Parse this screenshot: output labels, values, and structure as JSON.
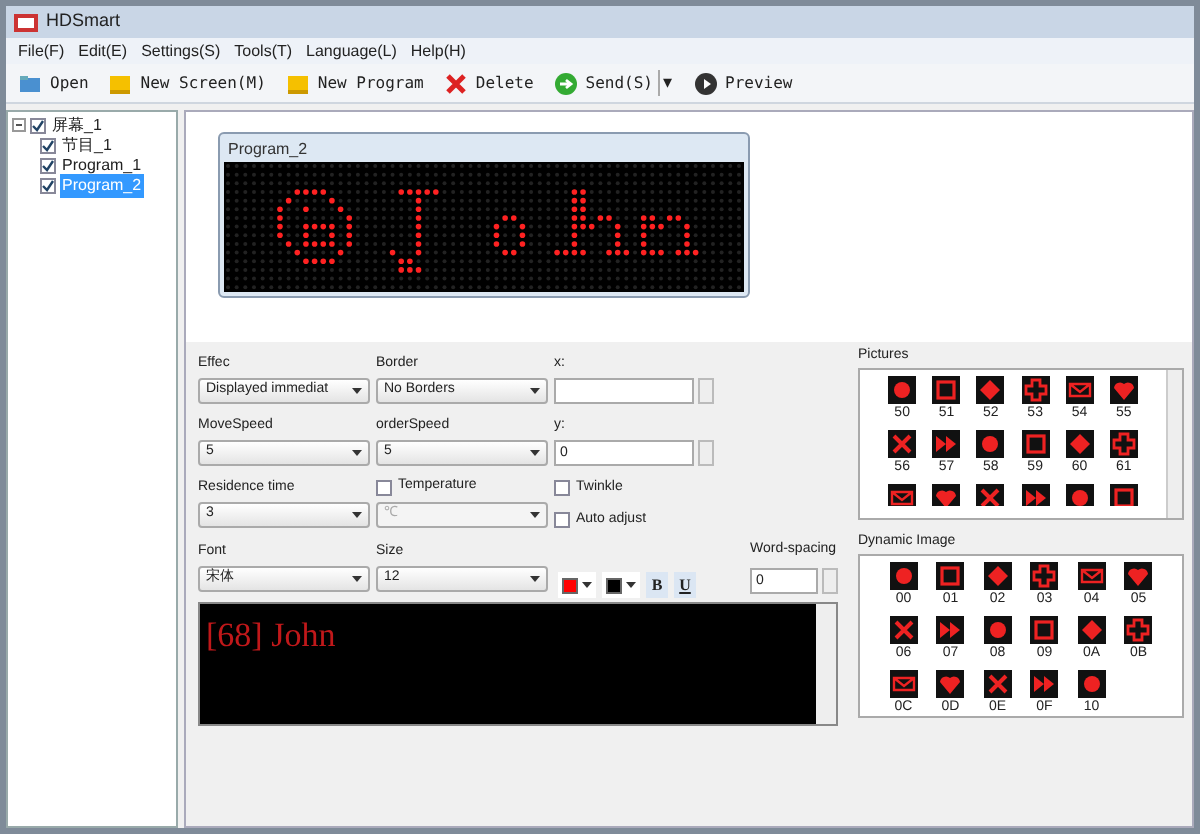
{
  "window": {
    "title": "HDSmart"
  },
  "menu": [
    "File(F)",
    "Edit(E)",
    "Settings(S)",
    "Tools(T)",
    "Language(L)",
    "Help(H)"
  ],
  "toolbar": [
    {
      "kind": "open",
      "label": "Open"
    },
    {
      "kind": "screen",
      "label": "New Screen(M)"
    },
    {
      "kind": "program",
      "label": "New Program"
    },
    {
      "kind": "delete",
      "label": "Delete"
    },
    {
      "kind": "send",
      "label": "Send(S)"
    },
    {
      "kind": "dropdown",
      "label": "▾"
    },
    {
      "kind": "preview",
      "label": "Preview"
    }
  ],
  "tree": [
    {
      "label": "屏幕_1",
      "checked": true,
      "expanded": true,
      "selected": false,
      "children": [
        {
          "label": "节目_1",
          "checked": true,
          "selected": false
        },
        {
          "label": "Program_1",
          "checked": true,
          "selected": false
        },
        {
          "label": "Program_2",
          "checked": true,
          "selected": true
        }
      ]
    }
  ],
  "preview": {
    "title": "Program_2"
  },
  "properties": [
    {
      "kind": "select",
      "label": "Effec",
      "value": "Displayed immediat"
    },
    {
      "kind": "select",
      "label": "Border",
      "value": "No Borders"
    },
    {
      "kind": "spin",
      "label": "x:"
    },
    {
      "kind": "select",
      "label": "MoveSpeed",
      "value": "5"
    },
    {
      "kind": "select",
      "label": "orderSpeed",
      "value": "5"
    },
    {
      "kind": "spin",
      "label": "y:",
      "value": "0"
    },
    {
      "kind": "select",
      "label": "Residence time",
      "value": "3"
    },
    {
      "kind": "checkselect",
      "label": "Temperature",
      "checked": false,
      "value": "℃",
      "disabled": true
    },
    {
      "kind": "checks",
      "items": [
        {
          "label": "Twinkle",
          "checked": false
        },
        {
          "label": "Auto adjust",
          "checked": false
        }
      ]
    },
    {
      "kind": "select",
      "label": "Font",
      "value": "宋体"
    },
    {
      "kind": "select",
      "label": "Size",
      "value": "12"
    }
  ],
  "format": {
    "swatches": [
      {
        "color": "#ff0000"
      },
      {
        "color": "#000000"
      }
    ],
    "bold_label": "B",
    "underline_label": "U",
    "spacing_label": "Word-spacing",
    "spacing_value": "0"
  },
  "editor": {
    "text": "[68]  John"
  },
  "pictures": {
    "title": "Pictures",
    "items": [
      {
        "label": "50"
      },
      {
        "label": "51"
      },
      {
        "label": "52"
      },
      {
        "label": "53"
      },
      {
        "label": "54"
      },
      {
        "label": "55"
      },
      {
        "label": "56"
      },
      {
        "label": "57"
      },
      {
        "label": "58"
      },
      {
        "label": "59"
      },
      {
        "label": "60"
      },
      {
        "label": "61"
      },
      {
        "kind": "cut"
      },
      {
        "kind": "cut"
      },
      {
        "kind": "cut"
      },
      {
        "kind": "cut"
      },
      {
        "kind": "cut"
      },
      {
        "kind": "cut"
      }
    ]
  },
  "dynamic": {
    "title": "Dynamic Image",
    "items": [
      {
        "label": "00"
      },
      {
        "label": "01"
      },
      {
        "label": "02"
      },
      {
        "label": "03"
      },
      {
        "label": "04"
      },
      {
        "label": "05"
      },
      {
        "label": "06"
      },
      {
        "label": "07"
      },
      {
        "label": "08"
      },
      {
        "label": "09"
      },
      {
        "label": "0A"
      },
      {
        "label": "0B"
      },
      {
        "label": "0C"
      },
      {
        "label": "0D"
      },
      {
        "label": "0E"
      },
      {
        "label": "0F"
      },
      {
        "label": "10"
      }
    ]
  }
}
